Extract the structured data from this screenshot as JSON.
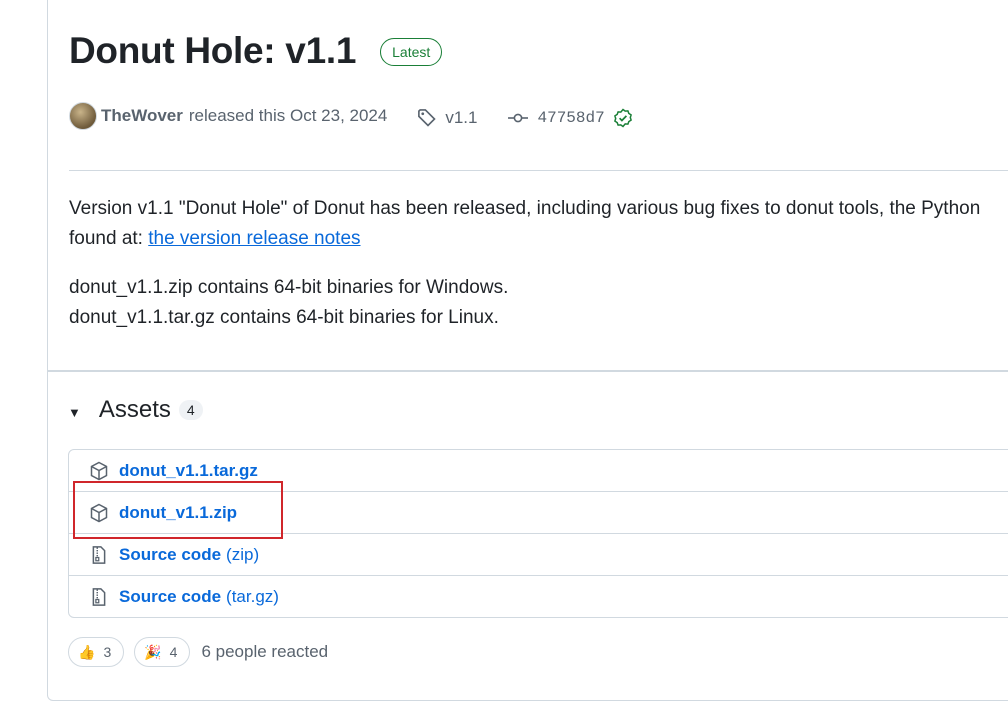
{
  "release": {
    "title": "Donut Hole: v1.1",
    "badge": "Latest",
    "author": "TheWover",
    "released_text": "released this Oct 23, 2024",
    "tag": "v1.1",
    "commit": "47758d7"
  },
  "description": {
    "line1": "Version v1.1 \"Donut Hole\" of Donut has been released, including various bug fixes to donut tools, the Python",
    "line2_prefix": "found at: ",
    "link_text": "the version release notes",
    "line3": "donut_v1.1.zip contains 64-bit binaries for Windows.",
    "line4": "donut_v1.1.tar.gz contains 64-bit binaries for Linux."
  },
  "assets": {
    "title": "Assets",
    "count": "4",
    "items": [
      {
        "name": "donut_v1.1.tar.gz",
        "suffix": "",
        "icon": "package-icon"
      },
      {
        "name": "donut_v1.1.zip",
        "suffix": "",
        "icon": "package-icon"
      },
      {
        "name": "Source code",
        "suffix": "(zip)",
        "icon": "file-zip-icon"
      },
      {
        "name": "Source code",
        "suffix": "(tar.gz)",
        "icon": "file-zip-icon"
      }
    ]
  },
  "reactions": {
    "items": [
      {
        "emoji": "👍",
        "count": "3",
        "icon": "thumbs-up-icon"
      },
      {
        "emoji": "🎉",
        "count": "4",
        "icon": "tada-icon"
      }
    ],
    "summary": "6 people reacted"
  },
  "colors": {
    "link": "#0969da",
    "latest_badge": "#1a7f37",
    "highlight_box": "#d0262b"
  }
}
